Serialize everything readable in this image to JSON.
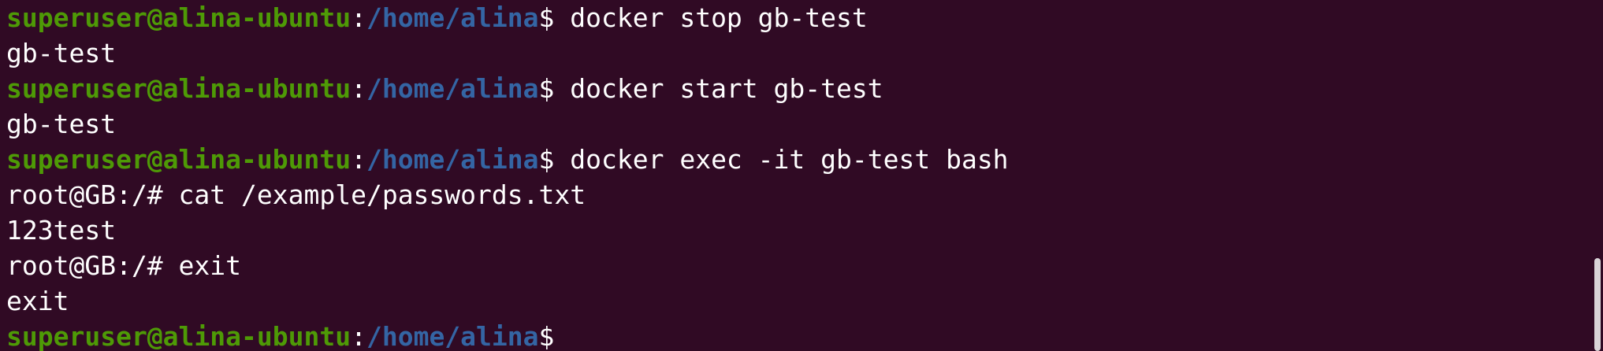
{
  "colors": {
    "background": "#300a24",
    "user_host": "#4e9a06",
    "path": "#3465a4",
    "text": "#ffffff",
    "scroll_thumb": "#d9d4d7"
  },
  "prompt": {
    "user_host": "superuser@alina-ubuntu",
    "colon": ":",
    "path": "/home/alina",
    "dollar": "$"
  },
  "lines": [
    {
      "type": "prompt",
      "command": " docker stop gb-test"
    },
    {
      "type": "output",
      "text": "gb-test"
    },
    {
      "type": "prompt",
      "command": " docker start gb-test"
    },
    {
      "type": "output",
      "text": "gb-test"
    },
    {
      "type": "prompt",
      "command": " docker exec -it gb-test bash"
    },
    {
      "type": "output",
      "text": "root@GB:/# cat /example/passwords.txt"
    },
    {
      "type": "output",
      "text": "123test"
    },
    {
      "type": "output",
      "text": "root@GB:/# exit"
    },
    {
      "type": "output",
      "text": "exit"
    },
    {
      "type": "prompt",
      "command": ""
    }
  ]
}
